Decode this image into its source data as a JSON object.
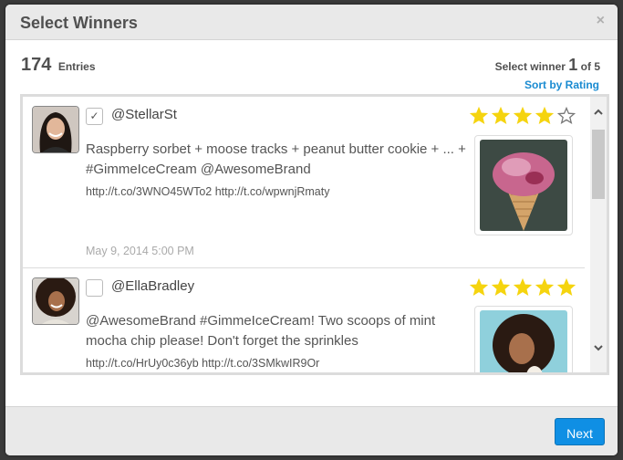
{
  "modal": {
    "title": "Select Winners",
    "close_icon": "×"
  },
  "summary": {
    "entries_count": "174",
    "entries_label": "Entries",
    "winner_prefix": "Select winner",
    "winner_current": "1",
    "winner_suffix": "of 5",
    "sort_link": "Sort by Rating"
  },
  "entries": [
    {
      "handle": "@StellarSt",
      "checked": true,
      "check_glyph": "✓",
      "text": "Raspberry sorbet + moose tracks + peanut butter cookie + ... + #GimmeIceCream @AwesomeBrand",
      "links": "http://t.co/3WNO45WTo2 http://t.co/wpwnjRmaty",
      "timestamp": "May 9, 2014 5:00 PM",
      "rating": 4,
      "max_rating": 5,
      "image": "raspberry-ice-cream-cone"
    },
    {
      "handle": "@EllaBradley",
      "checked": false,
      "check_glyph": "",
      "text": "@AwesomeBrand #GimmeIceCream! Two scoops of mint mocha chip please! Don't forget the sprinkles",
      "links": "http://t.co/HrUy0c36yb http://t.co/3SMkwIR9Or",
      "rating": 5,
      "max_rating": 5,
      "image": "woman-with-ice-cream"
    }
  ],
  "colors": {
    "star_filled": "#f5d40f",
    "star_empty": "#777777",
    "accent": "#0f8fe4",
    "link": "#1a8bd1"
  },
  "footer": {
    "next_label": "Next"
  }
}
